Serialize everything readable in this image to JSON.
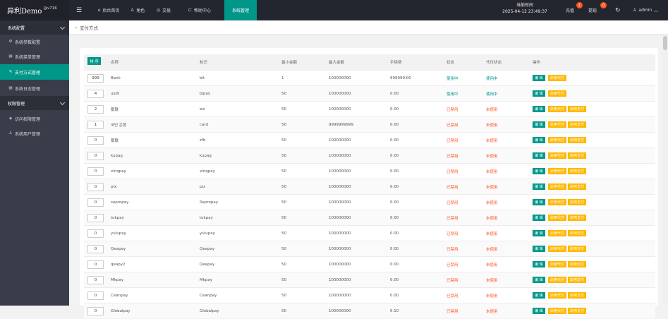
{
  "app": {
    "title": "异利Demo",
    "version": "@v716"
  },
  "nav": [
    {
      "label": "后台首页",
      "icon": "home-icon"
    },
    {
      "label": "角色",
      "icon": "user-icon"
    },
    {
      "label": "交易",
      "icon": "trade-icon"
    },
    {
      "label": "帮助中心",
      "icon": "help-icon"
    },
    {
      "label": "系统管理",
      "icon": "",
      "active": true
    }
  ],
  "time": {
    "label": "当前时间",
    "value": "2025-04-12 23:49:37"
  },
  "topbar": {
    "recharge_label": "充值",
    "recharge_badge": "1",
    "withdraw_label": "提现",
    "withdraw_badge": "0",
    "refresh_icon": "refresh-icon",
    "user_label": "admin"
  },
  "sidebar": {
    "items": [
      {
        "label": "系统配置",
        "type": "group",
        "icon": ""
      },
      {
        "label": "系统参数配置",
        "type": "item",
        "icon": "gear-icon"
      },
      {
        "label": "系统菜单管理",
        "type": "item",
        "icon": "menu-icon"
      },
      {
        "label": "支付方式管理",
        "type": "item",
        "icon": "wand-icon",
        "active": true
      },
      {
        "label": "系统日志管理",
        "type": "item",
        "icon": "log-icon"
      },
      {
        "label": "权限管理",
        "type": "group",
        "icon": ""
      },
      {
        "label": "访问权限管理",
        "type": "item",
        "icon": "shield-icon"
      },
      {
        "label": "系统用户管理",
        "type": "item",
        "icon": "users-icon"
      }
    ]
  },
  "breadcrumb": "支付方式",
  "table": {
    "sort_button": "排 序",
    "headers": [
      "名称",
      "标识",
      "最小金额",
      "最大金额",
      "手续费",
      "状态",
      "代付状态",
      "操作"
    ],
    "edit_label": "编 辑",
    "rows": [
      {
        "sort": "999",
        "name": "Bank",
        "code": "bit",
        "min": "1",
        "max": "100000000",
        "fee": "999999.00",
        "status": "使用中",
        "payout": "使用中",
        "actions": [
          "启用代付"
        ]
      },
      {
        "sort": "4",
        "name": "usdt",
        "code": "bipay",
        "min": "50",
        "max": "100000000",
        "fee": "0.00",
        "status": "使用中",
        "payout": "使用中",
        "actions": [
          "启用代付"
        ]
      },
      {
        "sort": "2",
        "name": "银联",
        "code": "wx",
        "min": "50",
        "max": "100000000",
        "fee": "0.00",
        "status": "已禁用",
        "payout": "未使用",
        "actions": [
          "启用代付",
          "启用支付"
        ]
      },
      {
        "sort": "1",
        "name": "국민 은행",
        "code": "card",
        "min": "50",
        "max": "9999999999",
        "fee": "0.00",
        "status": "已禁用",
        "payout": "未使用",
        "actions": [
          "启用代付",
          "启用支付"
        ]
      },
      {
        "sort": "0",
        "name": "银联",
        "code": "zfb",
        "min": "50",
        "max": "100000000",
        "fee": "0.00",
        "status": "已禁用",
        "payout": "未使用",
        "actions": [
          "启用代付",
          "启用支付"
        ]
      },
      {
        "sort": "0",
        "name": "kupag",
        "code": "kupag",
        "min": "50",
        "max": "100000000",
        "fee": "0.00",
        "status": "已禁用",
        "payout": "未使用",
        "actions": [
          "启用代付",
          "启用支付"
        ]
      },
      {
        "sort": "0",
        "name": "xinqpay",
        "code": "xinqpay",
        "min": "50",
        "max": "100000000",
        "fee": "0.00",
        "status": "已禁用",
        "payout": "未使用",
        "actions": [
          "启用代付",
          "启用支付"
        ]
      },
      {
        "sort": "0",
        "name": "pix",
        "code": "pix",
        "min": "50",
        "max": "100000000",
        "fee": "0.00",
        "status": "已禁用",
        "payout": "未使用",
        "actions": [
          "启用代付",
          "启用支付"
        ]
      },
      {
        "sort": "0",
        "name": "sepropay",
        "code": "Sepropay",
        "min": "50",
        "max": "100000000",
        "fee": "0.00",
        "status": "已禁用",
        "payout": "未使用",
        "actions": [
          "启用代付",
          "启用支付"
        ]
      },
      {
        "sort": "0",
        "name": "tokpay",
        "code": "tokpay",
        "min": "50",
        "max": "100000000",
        "fee": "0.00",
        "status": "已禁用",
        "payout": "未使用",
        "actions": [
          "启用代付",
          "启用支付"
        ]
      },
      {
        "sort": "0",
        "name": "yulupay",
        "code": "yulupay",
        "min": "50",
        "max": "100000000",
        "fee": "0.00",
        "status": "已禁用",
        "payout": "未使用",
        "actions": [
          "启用代付",
          "启用支付"
        ]
      },
      {
        "sort": "0",
        "name": "Qeapay",
        "code": "Qeapay",
        "min": "50",
        "max": "100000000",
        "fee": "0.00",
        "status": "已禁用",
        "payout": "未使用",
        "actions": [
          "启用代付",
          "启用支付"
        ]
      },
      {
        "sort": "0",
        "name": "qeapy2",
        "code": "Qeapay",
        "min": "50",
        "max": "100000000",
        "fee": "0.00",
        "status": "已禁用",
        "payout": "未使用",
        "actions": [
          "启用代付",
          "启用支付"
        ]
      },
      {
        "sort": "0",
        "name": "Mkpay",
        "code": "Mkpay",
        "min": "50",
        "max": "100000000",
        "fee": "0.00",
        "status": "已禁用",
        "payout": "未使用",
        "actions": [
          "启用代付",
          "启用支付"
        ]
      },
      {
        "sort": "0",
        "name": "Ceanpay",
        "code": "Ceanpay",
        "min": "50",
        "max": "100000000",
        "fee": "0.00",
        "status": "已禁用",
        "payout": "未使用",
        "actions": [
          "启用代付",
          "启用支付"
        ]
      },
      {
        "sort": "0",
        "name": "Globalpay",
        "code": "Globalpay",
        "min": "50",
        "max": "100000000",
        "fee": "0.10",
        "status": "已禁用",
        "payout": "未使用",
        "actions": [
          "启用代付",
          "启用支付"
        ]
      }
    ]
  },
  "colors": {
    "accent": "#009688",
    "warn": "#ffb800",
    "danger": "#ff5722",
    "topbar": "#23262e",
    "sidebar": "#393d49"
  }
}
